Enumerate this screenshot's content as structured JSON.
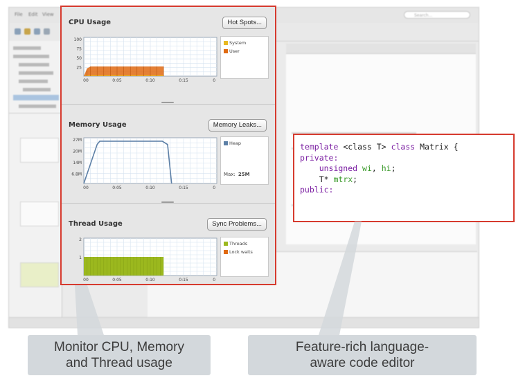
{
  "ide": {
    "menu_items": [
      "File",
      "Edit",
      "View"
    ],
    "search_placeholder": "Search..."
  },
  "panel": {
    "cpu": {
      "title": "CPU Usage",
      "button": "Hot Spots...",
      "y_ticks": [
        "100",
        "75",
        "50",
        "25"
      ],
      "x_ticks": [
        "00",
        "0:05",
        "0:10",
        "0:15",
        "0"
      ],
      "legend": [
        {
          "label": "System",
          "color": "#e8b820"
        },
        {
          "label": "User",
          "color": "#e06a12"
        }
      ]
    },
    "memory": {
      "title": "Memory Usage",
      "button": "Memory Leaks...",
      "y_ticks": [
        "27M",
        "20M",
        "14M",
        "6.8M"
      ],
      "x_ticks": [
        "00",
        "0:05",
        "0:10",
        "0:15",
        "0"
      ],
      "legend": [
        {
          "label": "Heap",
          "color": "#5c7fa6"
        }
      ],
      "max_label": "Max:",
      "max_value": "25M"
    },
    "thread": {
      "title": "Thread Usage",
      "button": "Sync Problems...",
      "y_ticks": [
        "2",
        "1"
      ],
      "x_ticks": [
        "00",
        "0:05",
        "0:10",
        "0:15",
        "0"
      ],
      "legend": [
        {
          "label": "Threads",
          "color": "#9bb81e"
        },
        {
          "label": "Lock waits",
          "color": "#e06a12"
        }
      ]
    }
  },
  "chart_data": [
    {
      "type": "area",
      "title": "CPU Usage",
      "x": [
        0,
        0.5,
        1,
        2,
        3,
        4,
        5,
        6,
        7,
        8,
        9,
        10,
        11,
        12
      ],
      "xlim": [
        0,
        20
      ],
      "ylim": [
        0,
        100
      ],
      "series": [
        {
          "name": "System",
          "values": [
            0,
            2,
            2,
            2,
            2,
            2,
            2,
            2,
            2,
            2,
            2,
            2,
            2,
            2
          ]
        },
        {
          "name": "User",
          "values": [
            0,
            20,
            25,
            25,
            25,
            25,
            25,
            25,
            25,
            25,
            25,
            25,
            25,
            25
          ]
        }
      ]
    },
    {
      "type": "line",
      "title": "Memory Usage",
      "x": [
        0,
        2,
        2.4,
        11.8,
        12.6,
        13.2
      ],
      "xlim": [
        0,
        20
      ],
      "ylim": [
        0,
        27
      ],
      "series": [
        {
          "name": "Heap",
          "values": [
            0,
            23,
            25,
            25,
            23,
            0
          ]
        }
      ]
    },
    {
      "type": "bar",
      "title": "Thread Usage",
      "x": [
        0,
        12
      ],
      "xlim": [
        0,
        20
      ],
      "ylim": [
        0,
        2
      ],
      "series": [
        {
          "name": "Threads",
          "values": [
            1,
            1
          ]
        },
        {
          "name": "Lock waits",
          "values": [
            0,
            0
          ]
        }
      ]
    }
  ],
  "code": {
    "lines": [
      [
        {
          "t": "template ",
          "c": "kw"
        },
        {
          "t": "<class T> ",
          "c": "tx"
        },
        {
          "t": "class ",
          "c": "kw"
        },
        {
          "t": "Matrix {",
          "c": "tx"
        }
      ],
      [
        {
          "t": "private:",
          "c": "kw"
        }
      ],
      [
        {
          "t": "    unsigned ",
          "c": "kw"
        },
        {
          "t": "wi",
          "c": "id"
        },
        {
          "t": ", ",
          "c": "tx"
        },
        {
          "t": "hi",
          "c": "id"
        },
        {
          "t": ";",
          "c": "tx"
        }
      ],
      [
        {
          "t": "    T* ",
          "c": "tx"
        },
        {
          "t": "mtrx",
          "c": "id"
        },
        {
          "t": ";",
          "c": "tx"
        }
      ],
      [
        {
          "t": "public:",
          "c": "kw"
        }
      ]
    ]
  },
  "captions": {
    "left_line1": "Monitor CPU, Memory",
    "left_line2": "and Thread usage",
    "right_line1": "Feature-rich language-",
    "right_line2": "aware code editor"
  },
  "colors": {
    "highlight": "#d63a2e",
    "caption_bg": "#d3d8dc",
    "chart_grid": "#d6e3f0"
  }
}
